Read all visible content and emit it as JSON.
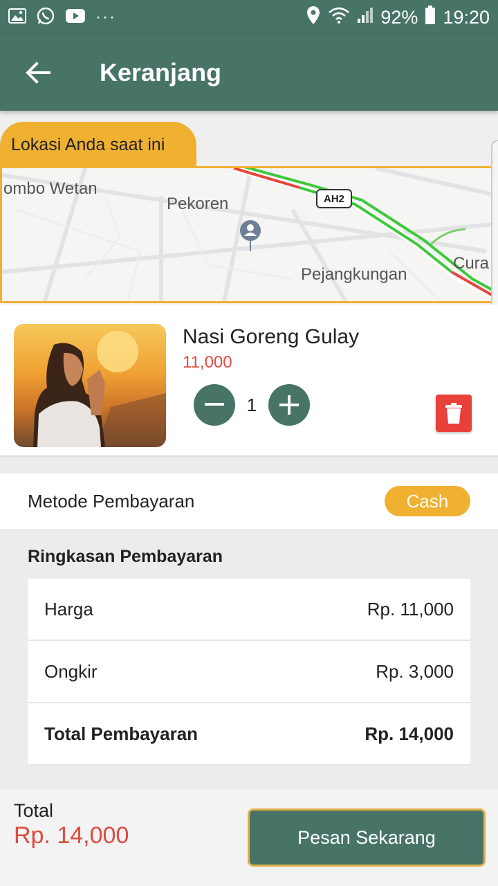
{
  "status_bar": {
    "icons_left": [
      "image-icon",
      "whatsapp-icon",
      "youtube-icon",
      "more-dots-icon"
    ],
    "icons_right": [
      "location-icon",
      "wifi-icon",
      "signal-icon",
      "battery-icon"
    ],
    "battery": "92%",
    "time": "19:20"
  },
  "header": {
    "title": "Keranjang",
    "back_icon": "arrow-left-icon"
  },
  "location": {
    "tab_label": "Lokasi Anda saat ini",
    "map_labels": [
      "ombo Wetan",
      "Pekoren",
      "Pejangkungan",
      "Cura"
    ],
    "road_shield": "AH2"
  },
  "cart_item": {
    "name": "Nasi Goreng Gulay",
    "price": "11,000",
    "quantity": "1"
  },
  "payment_method": {
    "label": "Metode Pembayaran",
    "value": "Cash"
  },
  "summary": {
    "title": "Ringkasan Pembayaran",
    "rows": [
      {
        "label": "Harga",
        "value": "Rp. 11,000"
      },
      {
        "label": "Ongkir",
        "value": "Rp. 3,000"
      },
      {
        "label": "Total Pembayaran",
        "value": "Rp. 14,000"
      }
    ]
  },
  "footer": {
    "total_label": "Total",
    "total_value": "Rp. 14,000",
    "order_button": "Pesan Sekarang"
  },
  "colors": {
    "primary": "#477466",
    "accent": "#f0b030",
    "price_red": "#e04a3f",
    "delete_red": "#e8413a"
  }
}
